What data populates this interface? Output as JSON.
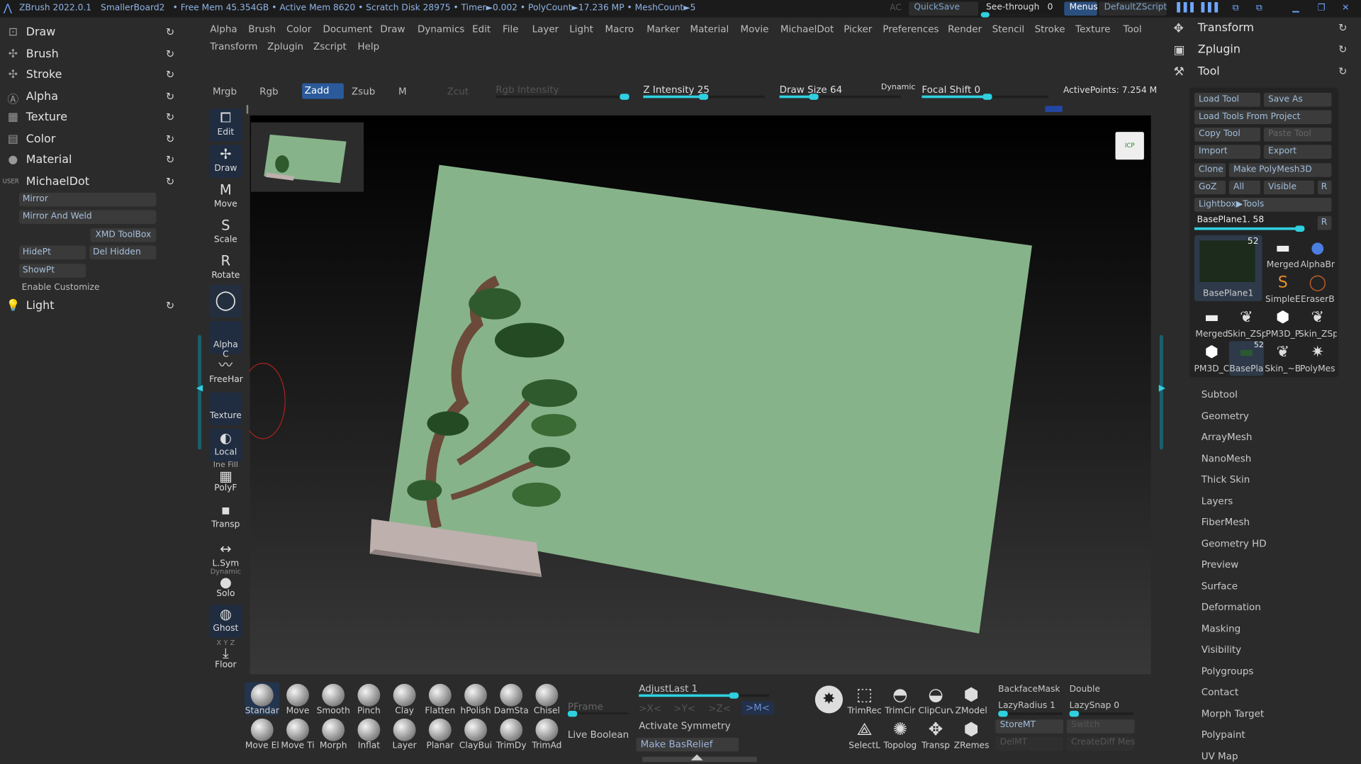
{
  "titlebar": {
    "app": "ZBrush 2022.0.1",
    "doc": "SmallerBoard2",
    "stats": "• Free Mem 45.354GB • Active Mem 8620 • Scratch Disk 28975 • Timer►0.002 • PolyCount►17.236 MP • MeshCount►5",
    "ac": "AC",
    "quicksave": "QuickSave",
    "seethrough": "See-through",
    "seethrough_val": "0",
    "menus": "Menus",
    "script": "DefaultZScript"
  },
  "left_panel": {
    "items": [
      {
        "label": "Draw",
        "icon": "draw-icon",
        "glyph": "⊡"
      },
      {
        "label": "Brush",
        "icon": "brush-icon",
        "glyph": "✣"
      },
      {
        "label": "Stroke",
        "icon": "stroke-icon",
        "glyph": "✣"
      },
      {
        "label": "Alpha",
        "icon": "alpha-icon",
        "glyph": "Ⓐ"
      },
      {
        "label": "Texture",
        "icon": "texture-icon",
        "glyph": "▦"
      },
      {
        "label": "Color",
        "icon": "color-icon",
        "glyph": "▤"
      },
      {
        "label": "Material",
        "icon": "material-icon",
        "glyph": "●"
      },
      {
        "label": "MichaelDot",
        "icon": "user-icon",
        "glyph": "USER"
      }
    ],
    "sub": {
      "mirror": "Mirror",
      "mirror_weld": "Mirror And Weld",
      "xmd": "XMD ToolBox",
      "hidept": "HidePt",
      "del_hidden": "Del Hidden",
      "showpt": "ShowPt",
      "enable_customize": "Enable Customize"
    },
    "light": "Light"
  },
  "menu_row1": [
    "Alpha",
    "Brush",
    "Color",
    "Document",
    "Draw",
    "Dynamics",
    "Edit",
    "File",
    "Layer",
    "Light",
    "Macro",
    "Marker",
    "Material",
    "Movie",
    "MichaelDot",
    "Picker",
    "Preferences",
    "Render",
    "Stencil",
    "Stroke",
    "Texture",
    "Tool"
  ],
  "menu_row2": [
    "Transform",
    "Zplugin",
    "Zscript",
    "Help"
  ],
  "top_shelf": {
    "mrgb": "Mrgb",
    "rgb": "Rgb",
    "zadd": "Zadd",
    "zsub": "Zsub",
    "m": "M",
    "zcut": "Zcut",
    "rgb_intensity": "Rgb Intensity",
    "z_intensity": "Z Intensity 25",
    "draw_size": "Draw Size 64",
    "dynamic": "Dynamic",
    "focal_shift": "Focal Shift 0",
    "active_points": "ActivePoints: 7.254 M"
  },
  "left_shelf": {
    "edit": "Edit",
    "draw": "Draw",
    "move": "Move",
    "scale": "Scale",
    "rotate": "Rotate",
    "alpha": "Alpha C",
    "freehand": "FreeHar",
    "texture": "Texture",
    "local": "Local",
    "polyf": "PolyF",
    "polyf_top": "Ine Fill",
    "transp": "Transp",
    "lsym": "L.Sym",
    "solo_top": "Dynamic",
    "solo": "Solo",
    "ghost": "Ghost",
    "floor": "Floor",
    "floor_top": "X Y Z"
  },
  "right_panel": {
    "headers": [
      {
        "label": "Transform",
        "icon": "transform-icon",
        "glyph": "✥"
      },
      {
        "label": "Zplugin",
        "icon": "zplugin-icon",
        "glyph": "▣"
      },
      {
        "label": "Tool",
        "icon": "tool-icon",
        "glyph": "⚒"
      }
    ],
    "tool_buttons": {
      "load_tool": "Load Tool",
      "save_as": "Save As",
      "load_project": "Load Tools From Project",
      "copy_tool": "Copy Tool",
      "paste_tool": "Paste Tool",
      "import": "Import",
      "export": "Export",
      "clone": "Clone",
      "make_polymesh": "Make PolyMesh3D",
      "goz": "GoZ",
      "all": "All",
      "visible": "Visible",
      "r": "R",
      "lightbox": "Lightbox▶Tools",
      "baseplane": "BasePlane1. 58",
      "r2": "R"
    },
    "thumbs": [
      {
        "label": "Merged",
        "num": ""
      },
      {
        "label": "AlphaBr",
        "num": ""
      },
      {
        "label": "SimpleE",
        "num": ""
      },
      {
        "label": "EraserB",
        "num": ""
      },
      {
        "label": "Merged",
        "num": ""
      },
      {
        "label": "Skin_ZSp",
        "num": ""
      },
      {
        "label": "PM3D_P",
        "num": ""
      },
      {
        "label": "Skin_ZSp",
        "num": ""
      },
      {
        "label": "PM3D_C",
        "num": ""
      },
      {
        "label": "BasePla",
        "num": "52"
      },
      {
        "label": "Skin_~B",
        "num": ""
      },
      {
        "label": "PolyMes",
        "num": ""
      }
    ],
    "big_thumb": {
      "label": "BasePlane1",
      "num": "52"
    },
    "subpalettes": [
      "Subtool",
      "Geometry",
      "ArrayMesh",
      "NanoMesh",
      "Thick Skin",
      "Layers",
      "FiberMesh",
      "Geometry HD",
      "Preview",
      "Surface",
      "Deformation",
      "Masking",
      "Visibility",
      "Polygroups",
      "Contact",
      "Morph Target",
      "Polypaint",
      "UV Map"
    ]
  },
  "bottom": {
    "brushes_row1": [
      "Standar",
      "Move",
      "Smooth",
      "Pinch",
      "Clay",
      "Flatten",
      "hPolish",
      "DamSta",
      "Chisel"
    ],
    "brushes_row2": [
      "Move El",
      "Move Ti",
      "Morph",
      "Inflat",
      "Layer",
      "Planar",
      "ClayBui",
      "TrimDy",
      "TrimAd"
    ],
    "pframe": "PFrame",
    "live_boolean": "Live Boolean",
    "adjust_last": "AdjustLast 1",
    "sym_x": ">X<",
    "sym_y": ">Y<",
    "sym_z": ">Z<",
    "sym_m": ">M<",
    "activate_symmetry": "Activate Symmetry",
    "make_basrelief": "Make BasRelief",
    "tools_row1": [
      "TrimRec",
      "TrimCir",
      "ClipCurv",
      "ZModel"
    ],
    "tools_row2": [
      "SelectL",
      "Topolog",
      "Transp",
      "ZRemes"
    ],
    "backface": "BackfaceMask",
    "double": "Double",
    "lazy_radius": "LazyRadius 1",
    "lazy_snap": "LazySnap 0",
    "storemt": "StoreMT",
    "switch": "Switch",
    "delmt": "DelMT",
    "creatediff": "CreateDiff Mesh"
  },
  "canvas_badge": "ICP"
}
